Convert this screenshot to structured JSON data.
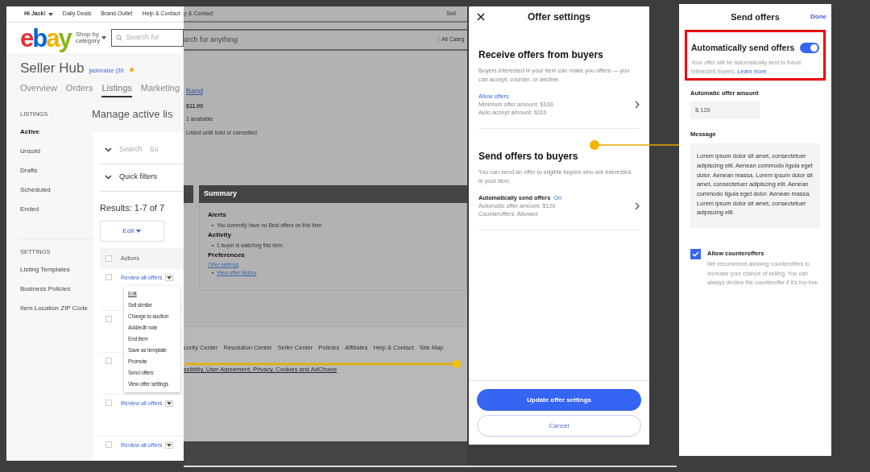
{
  "seller_hub": {
    "greeting": "Hi Jack!",
    "top_links": [
      "Daily Deals",
      "Brand Outlet",
      "Help & Contact"
    ],
    "logo_letters": [
      {
        "text": "e",
        "color": "#e53238"
      },
      {
        "text": "b",
        "color": "#0064d2"
      },
      {
        "text": "a",
        "color": "#f5af02"
      },
      {
        "text": "y",
        "color": "#86b817"
      }
    ],
    "shop_by": "Shop by category",
    "search_placeholder": "Search for",
    "title": "Seller Hub",
    "user": "jackmaize (39",
    "tabs": [
      {
        "label": "Overview",
        "selected": false
      },
      {
        "label": "Orders",
        "selected": false
      },
      {
        "label": "Listings",
        "selected": true
      },
      {
        "label": "Marketing",
        "selected": false
      }
    ],
    "sidebar": [
      {
        "heading": "LISTINGS",
        "items": [
          {
            "label": "Active",
            "selected": true
          },
          {
            "label": "Unsold",
            "selected": false
          },
          {
            "label": "Drafts",
            "selected": false
          },
          {
            "label": "Scheduled",
            "selected": false
          },
          {
            "label": "Ended",
            "selected": false
          }
        ]
      },
      {
        "heading": "SETTINGS",
        "items": [
          {
            "label": "Listing Templates",
            "selected": false
          },
          {
            "label": "Business Policies",
            "selected": false
          },
          {
            "label": "Item Location ZIP Code",
            "selected": false
          }
        ]
      }
    ],
    "page_title": "Manage active lis",
    "search_label": "Search",
    "search_next": "Su",
    "quick_filters": "Quick filters",
    "results": "Results: 1-7 of 7",
    "edit_button": "Edit",
    "table": {
      "columns": [
        "Actions"
      ],
      "select_all_checked": false,
      "rows": [
        {
          "checked": false,
          "action": "Review all offers"
        },
        {
          "checked": false
        },
        {
          "checked": false
        },
        {
          "checked": false,
          "action": "Review all offers"
        },
        {
          "checked": false,
          "action": "Review all offers"
        }
      ]
    },
    "menu": [
      "Edit",
      "Sell similar",
      "Change to auction",
      "Add/edit note",
      "End item",
      "Save as template",
      "Promote",
      "Send offers",
      "View offer settings"
    ]
  },
  "item_page": {
    "top_link": "p & Contact",
    "sell": "Sell",
    "search_text": "arch for anything",
    "category": "All Categ",
    "item_title": "Band",
    "price": "$11.00",
    "available": "1 available",
    "duration": "Listed until sold or cancelled",
    "summary": {
      "title": "Summary",
      "sections": [
        {
          "heading": "Alerts",
          "bullets": [
            "You currently have no Best offers on this item"
          ]
        },
        {
          "heading": "Activity",
          "bullets": [
            "1 buyer is watching this item."
          ]
        },
        {
          "heading": "Preferences",
          "link": "Offer settings",
          "bullets": [
            "View offer history"
          ]
        }
      ]
    },
    "footer_links": [
      "curity Center",
      "Resolution Center",
      "Seller Center",
      "Policies",
      "Affiliates",
      "Help & Contact",
      "Site Map"
    ],
    "legal": "ssibility, User Agreement, Privacy, Cookies and AdChoice"
  },
  "offer_settings": {
    "title": "Offer settings",
    "sections": [
      {
        "heading": "Receive offers from buyers",
        "description": "Buyers interested in your item can make you offers — you can accept, counter, or decline.",
        "row_title": "Allow offers",
        "lines": [
          "Minimum offer amount: $100",
          "Auto accept amount: $110"
        ]
      },
      {
        "heading": "Send offers to buyers",
        "description": "You can send an offer to eligible buyers who are interested in your item.",
        "row_title": "Automatically send offers",
        "row_status": "On",
        "lines": [
          "Automatic offer amount: $120",
          "Counteroffers: Allowed"
        ]
      }
    ],
    "primary_button": "Update offer settings",
    "secondary_button": "Cancel"
  },
  "send_offers": {
    "title": "Send offers",
    "done": "Done",
    "auto_title": "Automatically send offers",
    "auto_on": true,
    "auto_description": "Your offer will be automatically sent to future interested buyers.",
    "learn_more": "Learn more",
    "amount_label": "Automatic offer amount",
    "amount_value": "$ 120",
    "message_label": "Message",
    "message": "Lorem ipsum dolor sit amet, consectetuer adipiscing elit. Aenean commodo ligula eget dolor. Aenean massa. Lorem ipsum dolor sit amet, consectetuer adipiscing elit. Aenean commodo ligula eget dolor. Aenean massa. Lorem ipsum dolor sit amet, consectetuer adipiscing elit.",
    "counteroffers": {
      "label": "Allow counteroffers",
      "checked": true,
      "description": "We recommend allowing counteroffers to increase your chance of selling. You can always decline the counteroffer if it's too low."
    }
  }
}
